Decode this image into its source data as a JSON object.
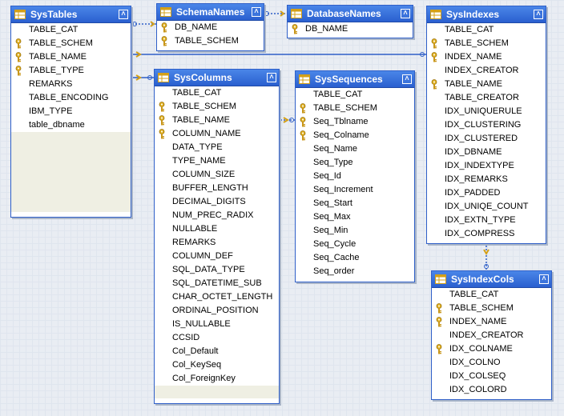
{
  "tables": [
    {
      "id": "systables",
      "name": "SysTables",
      "columns": [
        {
          "name": "TABLE_CAT",
          "key": false
        },
        {
          "name": "TABLE_SCHEM",
          "key": true
        },
        {
          "name": "TABLE_NAME",
          "key": true
        },
        {
          "name": "TABLE_TYPE",
          "key": true
        },
        {
          "name": "REMARKS",
          "key": false
        },
        {
          "name": "TABLE_ENCODING",
          "key": false
        },
        {
          "name": "IBM_TYPE",
          "key": false
        },
        {
          "name": "table_dbname",
          "key": false
        }
      ]
    },
    {
      "id": "schemanames",
      "name": "SchemaNames",
      "columns": [
        {
          "name": "DB_NAME",
          "key": true
        },
        {
          "name": "TABLE_SCHEM",
          "key": true
        }
      ]
    },
    {
      "id": "databasenames",
      "name": "DatabaseNames",
      "columns": [
        {
          "name": "DB_NAME",
          "key": true
        }
      ]
    },
    {
      "id": "sysindexes",
      "name": "SysIndexes",
      "columns": [
        {
          "name": "TABLE_CAT",
          "key": false
        },
        {
          "name": "TABLE_SCHEM",
          "key": true
        },
        {
          "name": "INDEX_NAME",
          "key": true
        },
        {
          "name": "INDEX_CREATOR",
          "key": false
        },
        {
          "name": "TABLE_NAME",
          "key": true
        },
        {
          "name": "TABLE_CREATOR",
          "key": false
        },
        {
          "name": "IDX_UNIQUERULE",
          "key": false
        },
        {
          "name": "IDX_CLUSTERING",
          "key": false
        },
        {
          "name": "IDX_CLUSTERED",
          "key": false
        },
        {
          "name": "IDX_DBNAME",
          "key": false
        },
        {
          "name": "IDX_INDEXTYPE",
          "key": false
        },
        {
          "name": "IDX_REMARKS",
          "key": false
        },
        {
          "name": "IDX_PADDED",
          "key": false
        },
        {
          "name": "IDX_UNIQE_COUNT",
          "key": false
        },
        {
          "name": "IDX_EXTN_TYPE",
          "key": false
        },
        {
          "name": "IDX_COMPRESS",
          "key": false
        }
      ]
    },
    {
      "id": "syscolumns",
      "name": "SysColumns",
      "columns": [
        {
          "name": "TABLE_CAT",
          "key": false
        },
        {
          "name": "TABLE_SCHEM",
          "key": true
        },
        {
          "name": "TABLE_NAME",
          "key": true
        },
        {
          "name": "COLUMN_NAME",
          "key": true
        },
        {
          "name": "DATA_TYPE",
          "key": false
        },
        {
          "name": "TYPE_NAME",
          "key": false
        },
        {
          "name": "COLUMN_SIZE",
          "key": false
        },
        {
          "name": "BUFFER_LENGTH",
          "key": false
        },
        {
          "name": "DECIMAL_DIGITS",
          "key": false
        },
        {
          "name": "NUM_PREC_RADIX",
          "key": false
        },
        {
          "name": "NULLABLE",
          "key": false
        },
        {
          "name": "REMARKS",
          "key": false
        },
        {
          "name": "COLUMN_DEF",
          "key": false
        },
        {
          "name": "SQL_DATA_TYPE",
          "key": false
        },
        {
          "name": "SQL_DATETIME_SUB",
          "key": false
        },
        {
          "name": "CHAR_OCTET_LENGTH",
          "key": false
        },
        {
          "name": "ORDINAL_POSITION",
          "key": false
        },
        {
          "name": "IS_NULLABLE",
          "key": false
        },
        {
          "name": "CCSID",
          "key": false
        },
        {
          "name": "Col_Default",
          "key": false
        },
        {
          "name": "Col_KeySeq",
          "key": false
        },
        {
          "name": "Col_ForeignKey",
          "key": false
        }
      ]
    },
    {
      "id": "syssequences",
      "name": "SysSequences",
      "columns": [
        {
          "name": "TABLE_CAT",
          "key": false
        },
        {
          "name": "TABLE_SCHEM",
          "key": true
        },
        {
          "name": "Seq_Tblname",
          "key": true
        },
        {
          "name": "Seq_Colname",
          "key": true
        },
        {
          "name": "Seq_Name",
          "key": false
        },
        {
          "name": "Seq_Type",
          "key": false
        },
        {
          "name": "Seq_Id",
          "key": false
        },
        {
          "name": "Seq_Increment",
          "key": false
        },
        {
          "name": "Seq_Start",
          "key": false
        },
        {
          "name": "Seq_Max",
          "key": false
        },
        {
          "name": "Seq_Min",
          "key": false
        },
        {
          "name": "Seq_Cycle",
          "key": false
        },
        {
          "name": "Seq_Cache",
          "key": false
        },
        {
          "name": "Seq_order",
          "key": false
        }
      ]
    },
    {
      "id": "sysindexcols",
      "name": "SysIndexCols",
      "columns": [
        {
          "name": "TABLE_CAT",
          "key": false
        },
        {
          "name": "TABLE_SCHEM",
          "key": true
        },
        {
          "name": "INDEX_NAME",
          "key": true
        },
        {
          "name": "INDEX_CREATOR",
          "key": false
        },
        {
          "name": "IDX_COLNAME",
          "key": true
        },
        {
          "name": "IDX_COLNO",
          "key": false
        },
        {
          "name": "IDX_COLSEQ",
          "key": false
        },
        {
          "name": "IDX_COLORD",
          "key": false
        }
      ]
    }
  ],
  "relationships": [
    {
      "from": "systables",
      "to": "schemanames"
    },
    {
      "from": "schemanames",
      "to": "databasenames"
    },
    {
      "from": "systables",
      "to": "sysindexes"
    },
    {
      "from": "systables",
      "to": "syscolumns"
    },
    {
      "from": "syscolumns",
      "to": "syssequences"
    },
    {
      "from": "sysindexes",
      "to": "sysindexcols"
    }
  ],
  "colors": {
    "header": "#2a5fcf",
    "border": "#2f5fc8",
    "key": "#d4a017",
    "filler": "#efefe3"
  },
  "icons": {
    "table": "table-icon",
    "key": "key-icon",
    "collapse": "collapse-chevron-icon"
  }
}
